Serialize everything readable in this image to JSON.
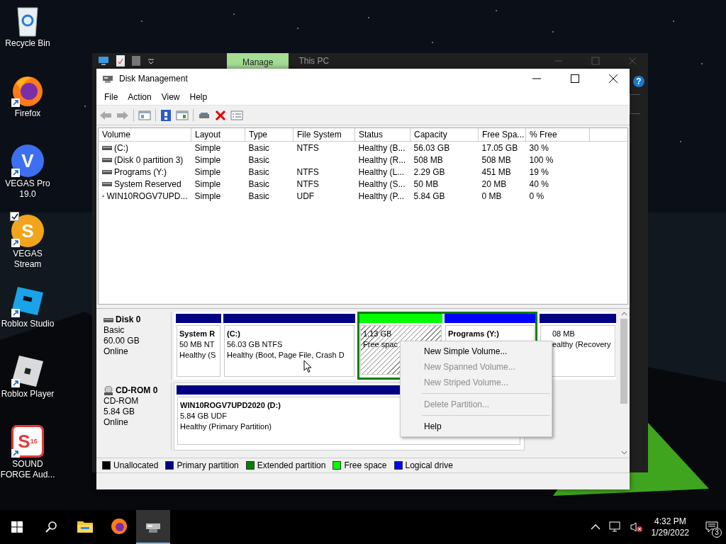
{
  "desktop_icons": [
    {
      "label": "Recycle Bin",
      "kind": "recycle",
      "shortcut": false
    },
    {
      "label": "Firefox",
      "kind": "firefox",
      "shortcut": true
    },
    {
      "label": "VEGAS Pro 19.0",
      "kind": "vegas-pro",
      "glyph": "V",
      "shortcut": true
    },
    {
      "label": "VEGAS Stream",
      "kind": "vegas-stream",
      "glyph": "S",
      "shortcut": true,
      "checked": true
    },
    {
      "label": "Roblox Studio",
      "kind": "roblox-studio",
      "shortcut": true
    },
    {
      "label": "Roblox Player",
      "kind": "roblox-player",
      "shortcut": true
    },
    {
      "label": "SOUND FORGE Aud...",
      "kind": "sound-forge",
      "glyph": "S",
      "badge": "15",
      "shortcut": true
    }
  ],
  "explorer": {
    "ribbon_tab": "Manage",
    "title": "This PC",
    "help_glyph": "?"
  },
  "window": {
    "title": "Disk Management",
    "menu": [
      "File",
      "Action",
      "View",
      "Help"
    ],
    "volumes": {
      "columns": [
        "Volume",
        "Layout",
        "Type",
        "File System",
        "Status",
        "Capacity",
        "Free Spa...",
        "% Free"
      ],
      "rows": [
        {
          "kind": "disk",
          "cells": [
            " (C:)",
            "Simple",
            "Basic",
            "NTFS",
            "Healthy (B...",
            "56.03 GB",
            "17.05 GB",
            "30 %"
          ]
        },
        {
          "kind": "disk",
          "cells": [
            "(Disk 0 partition 3)",
            "Simple",
            "Basic",
            "",
            "Healthy (R...",
            "508 MB",
            "508 MB",
            "100 %"
          ]
        },
        {
          "kind": "disk",
          "cells": [
            "Programs (Y:)",
            "Simple",
            "Basic",
            "NTFS",
            "Healthy (L...",
            "2.29 GB",
            "451 MB",
            "19 %"
          ]
        },
        {
          "kind": "disk",
          "cells": [
            "System Reserved",
            "Simple",
            "Basic",
            "NTFS",
            "Healthy (S...",
            "50 MB",
            "20 MB",
            "40 %"
          ]
        },
        {
          "kind": "cd",
          "cells": [
            "WIN10ROGV7UPD...",
            "Simple",
            "Basic",
            "UDF",
            "Healthy (P...",
            "5.84 GB",
            "0 MB",
            "0 %"
          ]
        }
      ]
    },
    "disks": [
      {
        "kind": "disk",
        "name": "Disk 0",
        "type": "Basic",
        "size": "60.00 GB",
        "state": "Online",
        "partitions": [
          {
            "kind": "primary",
            "selected": false,
            "name": "System R",
            "size": "50 MB NT",
            "status": "Healthy (S"
          },
          {
            "kind": "primary",
            "selected": false,
            "name": " (C:)",
            "size": "56.03 GB NTFS",
            "status": "Healthy (Boot, Page File, Crash D"
          },
          {
            "kind": "extended",
            "children": [
              {
                "kind": "free",
                "selected": true,
                "size": "1.13 GB",
                "status": "Free spac"
              },
              {
                "kind": "logical",
                "selected": false,
                "name": "Programs (Y:)"
              }
            ]
          },
          {
            "kind": "primary",
            "selected": false,
            "size": "08 MB",
            "status": "ealthy (Recovery"
          }
        ]
      },
      {
        "kind": "cd",
        "name": "CD-ROM 0",
        "type": "CD-ROM",
        "size": "5.84 GB",
        "state": "Online",
        "partitions": [
          {
            "kind": "primary",
            "selected": false,
            "name": "WIN10ROGV7UPD2020  (D:)",
            "size": "5.84 GB UDF",
            "status": "Healthy (Primary Partition)"
          }
        ]
      }
    ],
    "legend": [
      {
        "label": "Unallocated",
        "color": "#000000"
      },
      {
        "label": "Primary partition",
        "color": "#000080"
      },
      {
        "label": "Extended partition",
        "color": "#008000"
      },
      {
        "label": "Free space",
        "color": "#00ff00"
      },
      {
        "label": "Logical drive",
        "color": "#0000ff"
      }
    ]
  },
  "context_menu": [
    {
      "kind": "item",
      "label": "New Simple Volume...",
      "disabled": false
    },
    {
      "kind": "item",
      "label": "New Spanned Volume...",
      "disabled": true
    },
    {
      "kind": "item",
      "label": "New Striped Volume...",
      "disabled": true
    },
    {
      "kind": "separator"
    },
    {
      "kind": "item",
      "label": "Delete Partition...",
      "disabled": true
    },
    {
      "kind": "separator"
    },
    {
      "kind": "item",
      "label": "Help",
      "disabled": false
    }
  ],
  "taskbar": {
    "apps": [
      {
        "kind": "explorer",
        "selected": false
      },
      {
        "kind": "firefox",
        "selected": false
      },
      {
        "kind": "diskmgmt",
        "selected": true
      }
    ],
    "time": "4:32 PM",
    "date": "1/29/2022",
    "notification_count": "3"
  }
}
